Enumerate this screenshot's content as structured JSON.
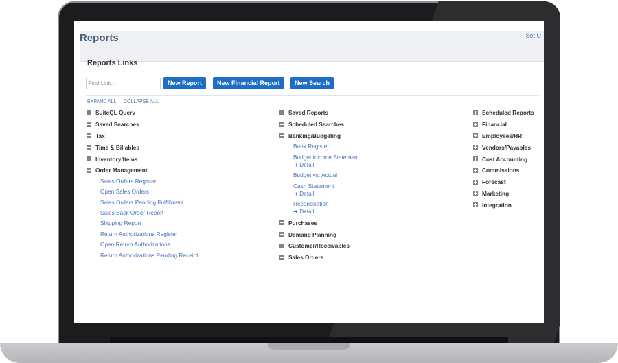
{
  "page": {
    "title": "Reports",
    "set_link": "Set U"
  },
  "reports_links": {
    "title": "Reports Links",
    "find_placeholder": "Find Link...",
    "buttons": [
      "New Report",
      "New Financial Report",
      "New Search"
    ],
    "expand_all": "EXPAND ALL",
    "collapse_all": "COLLAPSE ALL"
  },
  "left_column": {
    "categories": [
      "SuiteQL Query",
      "Saved Searches",
      "Tax",
      "Time & Billables",
      "Inventory/Items",
      "Order Management"
    ],
    "order_management_links": [
      "Sales Orders Register",
      "Open Sales Orders",
      "Sales Orders Pending Fulfillment",
      "Sales Back Order Report",
      "Shipping Report",
      "Return Authorizations Register",
      "Open Return Authorizations",
      "Return Authorizations Pending Receipt"
    ]
  },
  "middle_column": {
    "categories_top": [
      "Saved Reports",
      "Scheduled Searches",
      "Banking/Budgeting"
    ],
    "banking_links": [
      {
        "label": "Bank Register"
      },
      {
        "label": "Budget Income Statement",
        "detail": "➜ Detail"
      },
      {
        "label": "Budget vs. Actual"
      },
      {
        "label": "Cash Statement",
        "detail": "➜ Detail"
      },
      {
        "label": "Reconciliation",
        "detail": "➜ Detail"
      }
    ],
    "categories_bottom": [
      "Purchases",
      "Demand Planning",
      "Customer/Receivables",
      "Sales Orders"
    ]
  },
  "right_column": {
    "categories": [
      "Scheduled Reports",
      "Financial",
      "Employees/HR",
      "Vendors/Payables",
      "Cost Accounting",
      "Commissions",
      "Forecast",
      "Marketing",
      "Integration"
    ]
  },
  "icons": [
    "expand-plus-icon",
    "collapse-minus-icon"
  ],
  "colors": {
    "button": "#1e6ec8",
    "link": "#4a76b4",
    "title": "#4d5f79",
    "header_bg": "#eef0f3"
  }
}
